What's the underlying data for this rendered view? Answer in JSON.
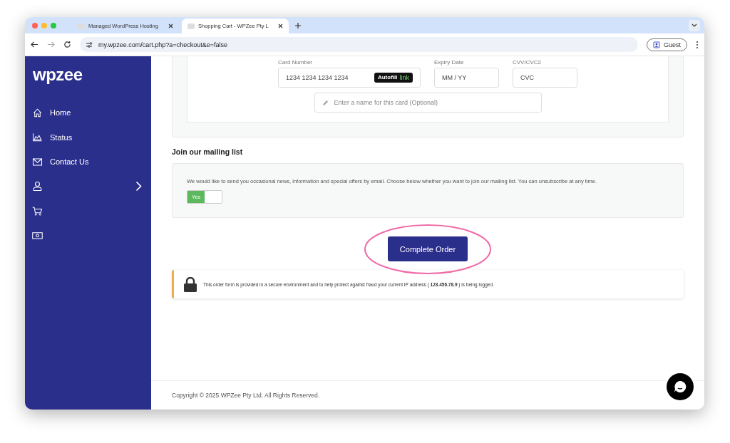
{
  "browser": {
    "tabs": [
      {
        "title": "Managed WordPress Hosting",
        "selected": false
      },
      {
        "title": "Shopping Cart - WPZee Pty L",
        "selected": true
      }
    ],
    "url": "my.wpzee.com/cart.php?a=checkout&e=false",
    "profile": "Guest"
  },
  "sidebar": {
    "logo": "wpzee",
    "items": [
      {
        "label": "Home",
        "has_submenu": false
      },
      {
        "label": "Status",
        "has_submenu": false
      },
      {
        "label": "Contact Us",
        "has_submenu": false
      },
      {
        "has_submenu": true
      },
      {
        "has_submenu": false
      },
      {
        "has_submenu": false
      }
    ]
  },
  "card_form": {
    "card_number": {
      "label": "Card Number",
      "placeholder": "1234 1234 1234 1234",
      "autofill": "Autofill",
      "autofill_brand": "link"
    },
    "expiry": {
      "label": "Expiry Date",
      "placeholder": "MM / YY"
    },
    "cvv": {
      "label": "CVV/CVC2",
      "placeholder": "CVC"
    },
    "card_name": {
      "placeholder": "Enter a name for this card (Optional)"
    }
  },
  "mailing_list": {
    "heading": "Join our mailing list",
    "text": "We would like to send you occasional news, information and special offers by email. Choose below whether you want to join our mailing list. You can unsubscribe at any time.",
    "toggle_label": "Yes",
    "on": true
  },
  "complete_button": "Complete Order",
  "secure_notice": "This order form is provided in a secure environment and to help protect against fraud your current IP address (  **123.456.78.9**  ) is being logged.",
  "footer": "Copyright © 2025 WPZee Pty Ltd. All Rights Reserved."
}
